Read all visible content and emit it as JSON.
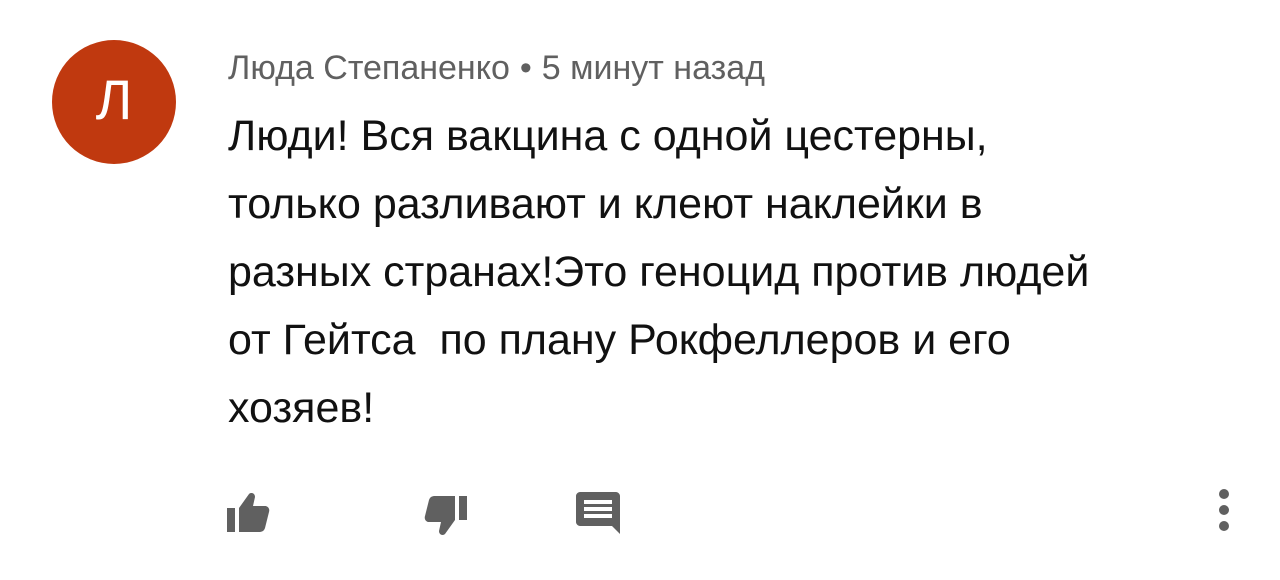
{
  "comment": {
    "avatar_letter": "Л",
    "avatar_color": "#c0390f",
    "author": "Люда Степаненко",
    "separator": "•",
    "time": "5 минут назад",
    "text": "Люди! Вся вакцина с одной цестерны,\nтолько разливают и клеют наклейки в\nразных странах!Это геноцид против людей\nот Гейтса  по плану Рокфеллеров и его\nхозяев!"
  },
  "actions": {
    "like_icon": "thumb-up-icon",
    "dislike_icon": "thumb-down-icon",
    "reply_icon": "comment-reply-icon",
    "menu_icon": "more-vertical-icon"
  }
}
